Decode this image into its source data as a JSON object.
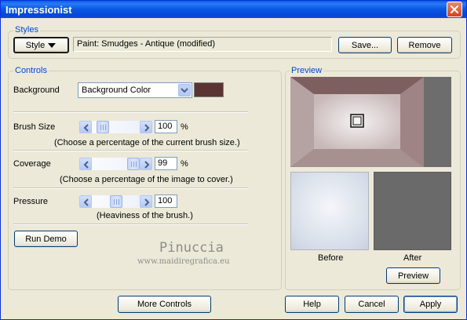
{
  "window": {
    "title": "Impressionist"
  },
  "styles": {
    "group_label": "Styles",
    "style_button": "Style",
    "preset_name": "Paint: Smudges - Antique (modified)",
    "save_button": "Save...",
    "remove_button": "Remove"
  },
  "controls": {
    "group_label": "Controls",
    "background": {
      "label": "Background",
      "selected": "Background Color",
      "swatch_color": "#5b3431"
    },
    "brush_size": {
      "label": "Brush Size",
      "value": "100",
      "unit": "%",
      "hint": "(Choose a percentage of the current brush size.)"
    },
    "coverage": {
      "label": "Coverage",
      "value": "99",
      "unit": "%",
      "hint": "(Choose a percentage of the image to cover.)"
    },
    "pressure": {
      "label": "Pressure",
      "value": "100",
      "hint": "(Heaviness of the brush.)"
    },
    "run_demo_button": "Run Demo"
  },
  "preview": {
    "group_label": "Preview",
    "before_label": "Before",
    "after_label": "After",
    "preview_button": "Preview"
  },
  "watermark": {
    "name": "Pinuccia",
    "url": "www.maidiregrafica.eu"
  },
  "footer": {
    "more_controls_button": "More Controls",
    "help_button": "Help",
    "cancel_button": "Cancel",
    "apply_button": "Apply"
  },
  "colors": {
    "titlebar": "#0a5ae6",
    "group_label": "#0046d5",
    "dialog_bg": "#ece9d8",
    "after_preview": "#6a6a6a"
  }
}
